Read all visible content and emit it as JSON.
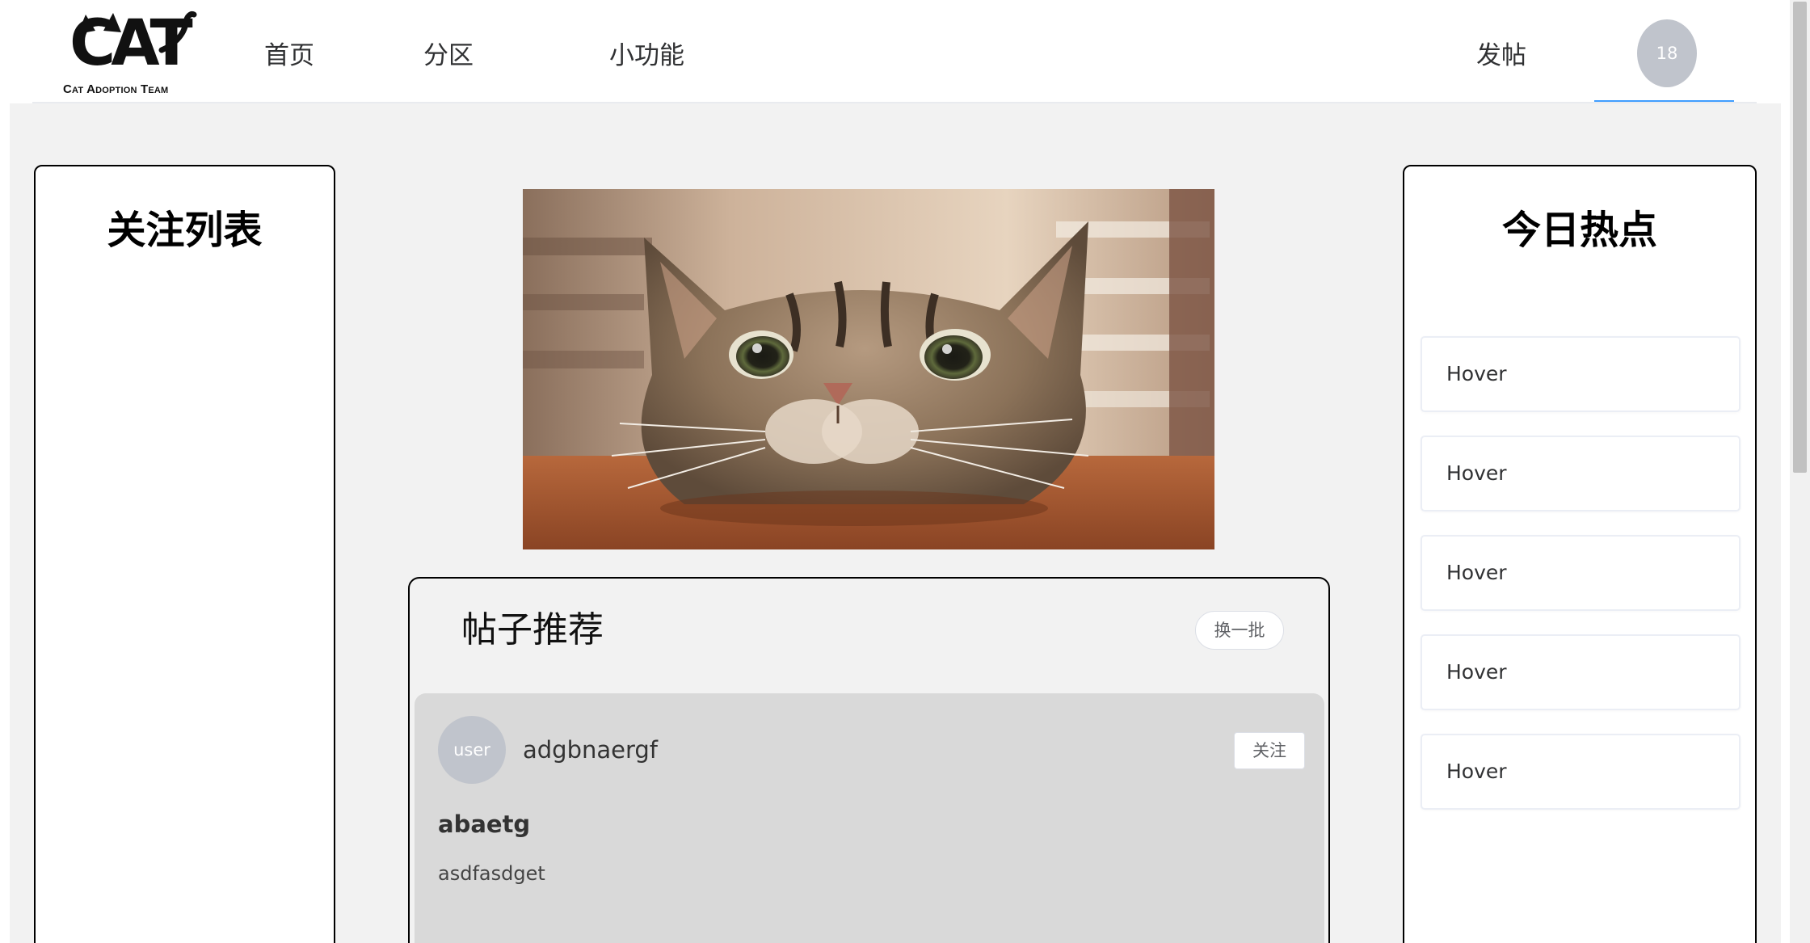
{
  "header": {
    "logo": {
      "word": "CAT",
      "subtitle": "Cat Adoption Team"
    },
    "nav": [
      "首页",
      "分区",
      "小功能"
    ],
    "post_label": "发帖",
    "avatar_text": "18",
    "accent_color": "#409eff"
  },
  "follow_list": {
    "title": "关注列表"
  },
  "banner": {
    "icon": "cat-photo"
  },
  "recommend": {
    "title": "帖子推荐",
    "refresh_label": "换一批",
    "posts": [
      {
        "avatar_text": "user",
        "username": "adgbnaergf",
        "follow_label": "关注",
        "title": "abaetg",
        "body": "asdfasdget"
      }
    ]
  },
  "hot_today": {
    "title": "今日热点",
    "items": [
      "Hover",
      "Hover",
      "Hover",
      "Hover",
      "Hover"
    ]
  }
}
